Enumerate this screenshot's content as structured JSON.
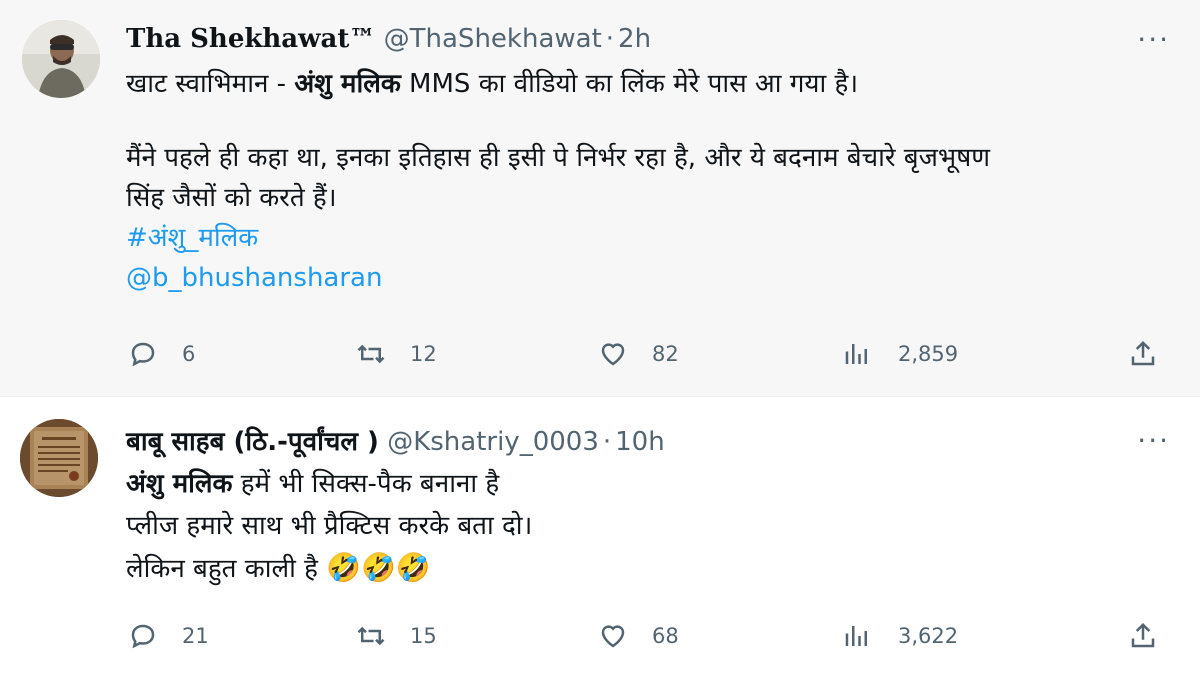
{
  "tweets": [
    {
      "avatar_icon": "user-avatar-photo",
      "display_name": "Tha Shekhawat™",
      "handle": "@ThaShekhawat",
      "separator": "·",
      "time": "2h",
      "more_label": "···",
      "body": {
        "line1_prefix": "खाट स्वाभिमान - ",
        "line1_bold": "अंशु मलिक",
        "line1_suffix": " MMS का वीडियो का लिंक मेरे पास आ गया है।",
        "line2": "मैंने पहले ही कहा था, इनका इतिहास ही इसी पे निर्भर रहा है, और ये बदनाम बेचारे बृजभूषण",
        "line3": "सिंह जैसों को करते हैं।",
        "hashtag": "#अंशु_मलिक",
        "mention": "@b_bhushansharan"
      },
      "actions": {
        "replies": "6",
        "retweets": "12",
        "likes": "82",
        "views": "2,859"
      }
    },
    {
      "avatar_icon": "certificate-avatar-image",
      "display_name": "बाबू साहब (ठि.-पूर्वांचल )",
      "handle": "@Kshatriy_0003",
      "separator": "·",
      "time": "10h",
      "more_label": "···",
      "body": {
        "line1_bold": "अंशु मलिक",
        "line1_suffix": "  हमें भी सिक्स-पैक बनाना है",
        "line2": "प्लीज हमारे साथ भी प्रैक्टिस करके बता दो।",
        "line3": "लेकिन बहुत काली है ",
        "emojis": "🤣🤣🤣"
      },
      "actions": {
        "replies": "21",
        "retweets": "15",
        "likes": "68",
        "views": "3,622"
      }
    }
  ],
  "colors": {
    "link": "#1d9bf0",
    "muted": "#536471",
    "text": "#0f1419",
    "tweet_bg_highlight": "#f7f7f7"
  }
}
